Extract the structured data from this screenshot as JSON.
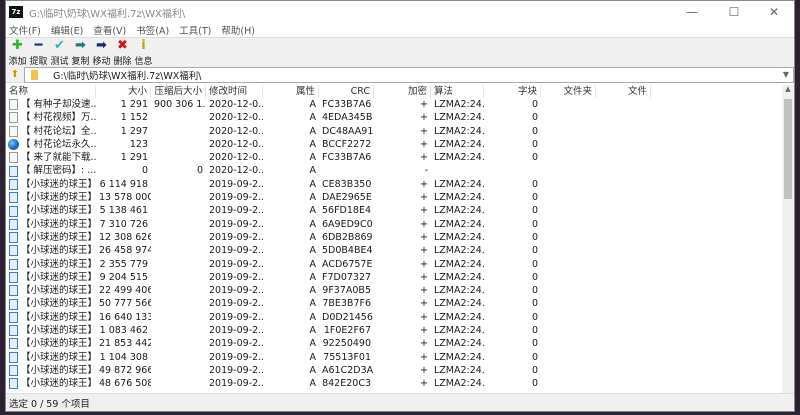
{
  "window": {
    "title": "G:\\临时\\奶球\\WX福利.7z\\WX福利\\",
    "app_icon": "7z",
    "minimize": "—",
    "maximize": "☐",
    "close": "✕"
  },
  "menu": [
    "文件(F)",
    "编辑(E)",
    "查看(V)",
    "书签(A)",
    "工具(T)",
    "帮助(H)"
  ],
  "toolbar": [
    {
      "label": "添加",
      "icon": "plus-icon",
      "glyph": "✚",
      "color": "#22bb22"
    },
    {
      "label": "提取",
      "icon": "minus-icon",
      "glyph": "━",
      "color": "#1a2ea8"
    },
    {
      "label": "测试",
      "icon": "check-icon",
      "glyph": "✔",
      "color": "#29b6c8"
    },
    {
      "label": "复制",
      "icon": "copy-arrow-icon",
      "glyph": "➡",
      "color": "#1f7a7a"
    },
    {
      "label": "移动",
      "icon": "move-arrow-icon",
      "glyph": "➡",
      "color": "#1a2a80"
    },
    {
      "label": "删除",
      "icon": "delete-icon",
      "glyph": "✖",
      "color": "#dd1111"
    },
    {
      "label": "信息",
      "icon": "info-icon",
      "glyph": "i",
      "color": "#c8a000"
    }
  ],
  "address": {
    "path": "G:\\临时\\奶球\\WX福利.7z\\WX福利\\"
  },
  "columns": [
    "名称",
    "大小",
    "压缩后大小",
    "修改时间",
    "属性",
    "CRC",
    "加密",
    "算法",
    "字块",
    "文件夹",
    "文件"
  ],
  "rows": [
    {
      "icon": "doc",
      "name": "【 有种子却没速...",
      "size": "1 291",
      "packed": "900 306 1...",
      "modified": "2020-12-0...",
      "attr": "A",
      "crc": "FC33B7A6",
      "enc": "+",
      "method": "LZMA2:24...",
      "block": "0"
    },
    {
      "icon": "doc",
      "name": "【 村花视频】万...",
      "size": "1 152",
      "packed": "",
      "modified": "2020-12-0...",
      "attr": "A",
      "crc": "4EDA345B",
      "enc": "+",
      "method": "LZMA2:24...",
      "block": "0"
    },
    {
      "icon": "doc",
      "name": "【 村花论坛】全...",
      "size": "1 297",
      "packed": "",
      "modified": "2020-12-0...",
      "attr": "A",
      "crc": "DC48AA91",
      "enc": "+",
      "method": "LZMA2:24...",
      "block": "0"
    },
    {
      "icon": "globe",
      "name": "【 村花论坛永久...",
      "size": "123",
      "packed": "",
      "modified": "2020-12-0...",
      "attr": "A",
      "crc": "BCCF2272",
      "enc": "+",
      "method": "LZMA2:24...",
      "block": "0"
    },
    {
      "icon": "doc",
      "name": "【 来了就能下载...",
      "size": "1 291",
      "packed": "",
      "modified": "2020-12-0...",
      "attr": "A",
      "crc": "FC33B7A6",
      "enc": "+",
      "method": "LZMA2:24...",
      "block": "0"
    },
    {
      "icon": "vid",
      "name": "【 解压密码】: ...",
      "size": "0",
      "packed": "0",
      "modified": "2020-12-0...",
      "attr": "A",
      "crc": "",
      "enc": "-",
      "method": "",
      "block": ""
    },
    {
      "icon": "vid",
      "name": "【小球迷的球王】...",
      "size": "6 114 918",
      "packed": "",
      "modified": "2019-09-2...",
      "attr": "A",
      "crc": "CE83B350",
      "enc": "+",
      "method": "LZMA2:24...",
      "block": "0"
    },
    {
      "icon": "vid",
      "name": "【小球迷的球王】...",
      "size": "13 578 000",
      "packed": "",
      "modified": "2019-09-2...",
      "attr": "A",
      "crc": "DAE2965E",
      "enc": "+",
      "method": "LZMA2:24...",
      "block": "0"
    },
    {
      "icon": "vid",
      "name": "【小球迷的球王】...",
      "size": "5 138 461",
      "packed": "",
      "modified": "2019-09-2...",
      "attr": "A",
      "crc": "56FD18E4",
      "enc": "+",
      "method": "LZMA2:24...",
      "block": "0"
    },
    {
      "icon": "vid",
      "name": "【小球迷的球王】...",
      "size": "7 310 726",
      "packed": "",
      "modified": "2019-09-2...",
      "attr": "A",
      "crc": "6A9ED9C0",
      "enc": "+",
      "method": "LZMA2:24...",
      "block": "0"
    },
    {
      "icon": "vid",
      "name": "【小球迷的球王】...",
      "size": "12 308 626",
      "packed": "",
      "modified": "2019-09-2...",
      "attr": "A",
      "crc": "6DB2B869",
      "enc": "+",
      "method": "LZMA2:24...",
      "block": "0"
    },
    {
      "icon": "vid",
      "name": "【小球迷的球王】...",
      "size": "26 458 974",
      "packed": "",
      "modified": "2019-09-2...",
      "attr": "A",
      "crc": "5D0B4BE4",
      "enc": "+",
      "method": "LZMA2:24...",
      "block": "0"
    },
    {
      "icon": "vid",
      "name": "【小球迷的球王】...",
      "size": "2 355 779",
      "packed": "",
      "modified": "2019-09-2...",
      "attr": "A",
      "crc": "ACD6757E",
      "enc": "+",
      "method": "LZMA2:24...",
      "block": "0"
    },
    {
      "icon": "vid",
      "name": "【小球迷的球王】...",
      "size": "9 204 515",
      "packed": "",
      "modified": "2019-09-2...",
      "attr": "A",
      "crc": "F7D07327",
      "enc": "+",
      "method": "LZMA2:24...",
      "block": "0"
    },
    {
      "icon": "vid",
      "name": "【小球迷的球王】...",
      "size": "22 499 406",
      "packed": "",
      "modified": "2019-09-2...",
      "attr": "A",
      "crc": "9F37A0B5",
      "enc": "+",
      "method": "LZMA2:24...",
      "block": "0"
    },
    {
      "icon": "vid",
      "name": "【小球迷的球王】...",
      "size": "50 777 566",
      "packed": "",
      "modified": "2019-09-2...",
      "attr": "A",
      "crc": "7BE3B7F6",
      "enc": "+",
      "method": "LZMA2:24...",
      "block": "0"
    },
    {
      "icon": "vid",
      "name": "【小球迷的球王】...",
      "size": "16 640 133",
      "packed": "",
      "modified": "2019-09-2...",
      "attr": "A",
      "crc": "D0D21456",
      "enc": "+",
      "method": "LZMA2:24...",
      "block": "0"
    },
    {
      "icon": "vid",
      "name": "【小球迷的球王】...",
      "size": "1 083 462",
      "packed": "",
      "modified": "2019-09-2...",
      "attr": "A",
      "crc": "1F0E2F67",
      "enc": "+",
      "method": "LZMA2:24...",
      "block": "0"
    },
    {
      "icon": "vid",
      "name": "【小球迷的球王】...",
      "size": "21 853 442",
      "packed": "",
      "modified": "2019-09-2...",
      "attr": "A",
      "crc": "92250490",
      "enc": "+",
      "method": "LZMA2:24...",
      "block": "0"
    },
    {
      "icon": "vid",
      "name": "【小球迷的球王】...",
      "size": "1 104 308",
      "packed": "",
      "modified": "2019-09-2...",
      "attr": "A",
      "crc": "75513F01",
      "enc": "+",
      "method": "LZMA2:24...",
      "block": "0"
    },
    {
      "icon": "vid",
      "name": "【小球迷的球王】...",
      "size": "49 872 966",
      "packed": "",
      "modified": "2019-09-2...",
      "attr": "A",
      "crc": "A61C2D3A",
      "enc": "+",
      "method": "LZMA2:24...",
      "block": "0"
    },
    {
      "icon": "vid",
      "name": "【小球迷的球王】...",
      "size": "48 676 508",
      "packed": "",
      "modified": "2019-09-2...",
      "attr": "A",
      "crc": "842E20C3",
      "enc": "+",
      "method": "LZMA2:24...",
      "block": "0"
    }
  ],
  "status": "选定 0 / 59 个项目"
}
